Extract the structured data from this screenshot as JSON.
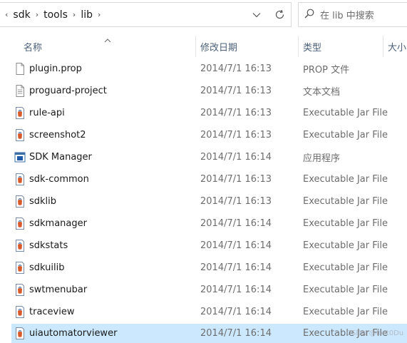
{
  "address_bar": {
    "segments": [
      "sdk",
      "tools",
      "lib"
    ],
    "overflow_chevron": "‹",
    "dropdown_icon": "chevron-down-icon",
    "refresh_icon": "refresh-icon"
  },
  "search": {
    "placeholder": "在 lib 中搜索",
    "icon": "search-icon"
  },
  "columns": {
    "name": "名称",
    "date": "修改日期",
    "type": "类型",
    "size": "大小"
  },
  "files": [
    {
      "name": "plugin.prop",
      "date": "2014/7/1 16:13",
      "type": "PROP 文件",
      "icon": "generic-file-icon"
    },
    {
      "name": "proguard-project",
      "date": "2014/7/1 16:13",
      "type": "文本文档",
      "icon": "text-file-icon"
    },
    {
      "name": "rule-api",
      "date": "2014/7/1 16:13",
      "type": "Executable Jar File",
      "icon": "jar-file-icon"
    },
    {
      "name": "screenshot2",
      "date": "2014/7/1 16:13",
      "type": "Executable Jar File",
      "icon": "jar-file-icon"
    },
    {
      "name": "SDK Manager",
      "date": "2014/7/1 16:14",
      "type": "应用程序",
      "icon": "application-icon"
    },
    {
      "name": "sdk-common",
      "date": "2014/7/1 16:13",
      "type": "Executable Jar File",
      "icon": "jar-file-icon"
    },
    {
      "name": "sdklib",
      "date": "2014/7/1 16:13",
      "type": "Executable Jar File",
      "icon": "jar-file-icon"
    },
    {
      "name": "sdkmanager",
      "date": "2014/7/1 16:14",
      "type": "Executable Jar File",
      "icon": "jar-file-icon"
    },
    {
      "name": "sdkstats",
      "date": "2014/7/1 16:14",
      "type": "Executable Jar File",
      "icon": "jar-file-icon"
    },
    {
      "name": "sdkuilib",
      "date": "2014/7/1 16:14",
      "type": "Executable Jar File",
      "icon": "jar-file-icon"
    },
    {
      "name": "swtmenubar",
      "date": "2014/7/1 16:14",
      "type": "Executable Jar File",
      "icon": "jar-file-icon"
    },
    {
      "name": "traceview",
      "date": "2014/7/1 16:14",
      "type": "Executable Jar File",
      "icon": "jar-file-icon"
    },
    {
      "name": "uiautomatorviewer",
      "date": "2014/7/1 16:14",
      "type": "Executable Jar File",
      "icon": "jar-file-icon",
      "selected": true
    }
  ],
  "watermark": "CSDN @lost0Du",
  "colors": {
    "selection": "#cce8ff",
    "header_text": "#4c607a",
    "secondary_text": "#6d6d6d"
  }
}
